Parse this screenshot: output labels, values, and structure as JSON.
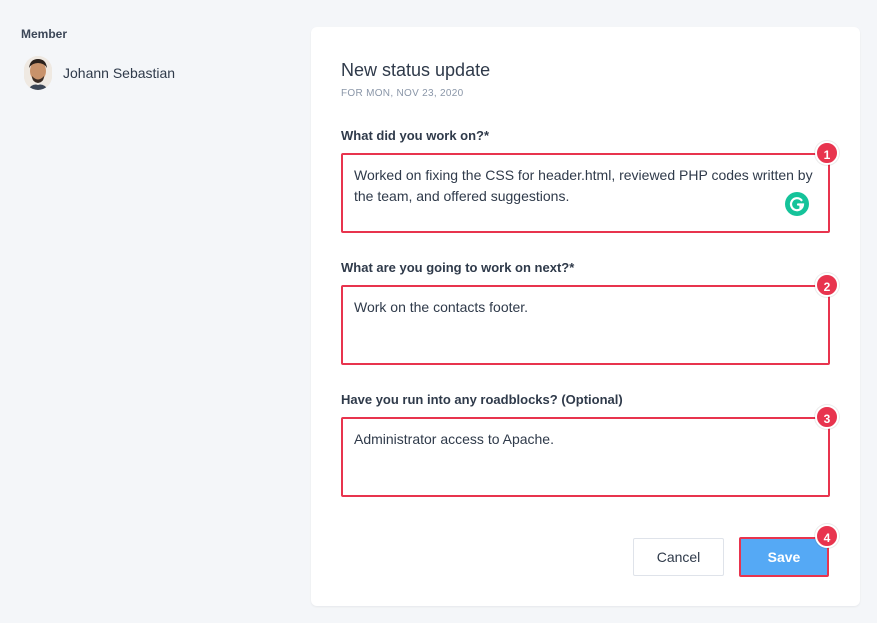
{
  "sidebar": {
    "heading": "Member",
    "member_name": "Johann Sebastian"
  },
  "form": {
    "title": "New status update",
    "subtitle": "FOR MON, NOV 23, 2020",
    "fields": [
      {
        "label": "What did you work on?*",
        "value": "Worked on fixing the CSS for header.html, reviewed PHP codes written by the team, and offered suggestions.",
        "badge": "1"
      },
      {
        "label": "What are you going to work on next?*",
        "value": "Work on the contacts footer.",
        "badge": "2"
      },
      {
        "label": "Have you run into any roadblocks? (Optional)",
        "value": "Administrator access to Apache.",
        "badge": "3"
      }
    ],
    "cancel_label": "Cancel",
    "save_label": "Save",
    "save_badge": "4"
  },
  "colors": {
    "highlight": "#e8344e",
    "save_button": "#55a9f5",
    "grammarly": "#15c39a"
  },
  "icons": {
    "grammarly": "grammarly-icon"
  }
}
